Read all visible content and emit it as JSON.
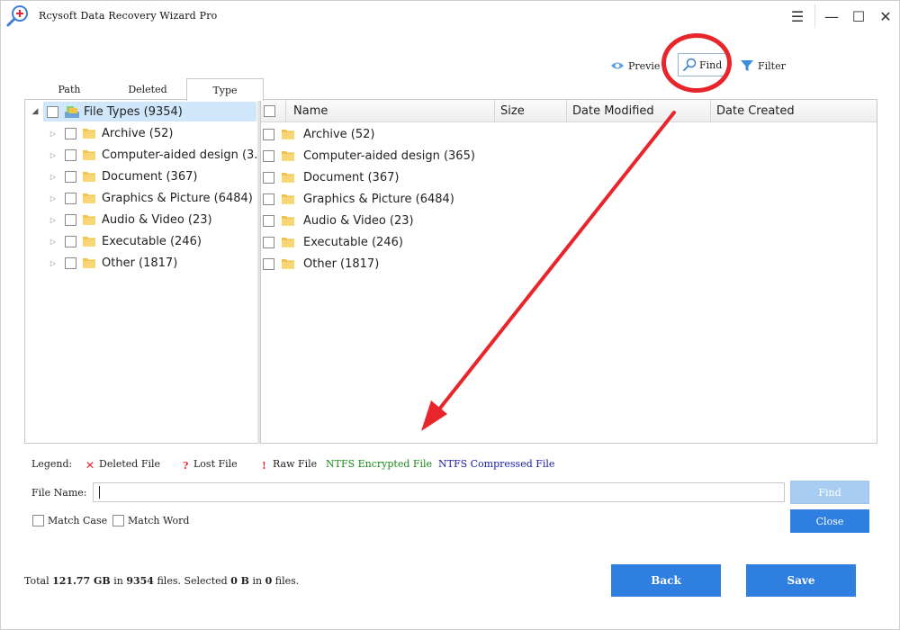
{
  "window": {
    "title": "Rcysoft Data Recovery Wizard Pro",
    "controls": {
      "menu": "☰",
      "minimize": "—",
      "maximize": "☐",
      "close": "✕"
    }
  },
  "toolbar": {
    "preview_label": "Previe",
    "find_label": "Find",
    "filter_label": "Filter"
  },
  "tabs": [
    {
      "label": "Path"
    },
    {
      "label": "Deleted"
    },
    {
      "label": "Type",
      "active": true
    }
  ],
  "tree": {
    "root": {
      "label": "File Types (9354)",
      "expander": "◢"
    },
    "items": [
      {
        "label": "Archive (52)"
      },
      {
        "label": "Computer-aided design (3..."
      },
      {
        "label": "Document (367)"
      },
      {
        "label": "Graphics & Picture (6484)"
      },
      {
        "label": "Audio & Video (23)"
      },
      {
        "label": "Executable (246)"
      },
      {
        "label": "Other (1817)"
      }
    ],
    "expander_glyph": "▷"
  },
  "list": {
    "columns": [
      "Name",
      "Size",
      "Date Modified",
      "Date Created"
    ],
    "rows": [
      {
        "name": "Archive (52)"
      },
      {
        "name": "Computer-aided design (365)"
      },
      {
        "name": "Document (367)"
      },
      {
        "name": "Graphics & Picture (6484)"
      },
      {
        "name": "Audio & Video (23)"
      },
      {
        "name": "Executable (246)"
      },
      {
        "name": "Other (1817)"
      }
    ]
  },
  "legend": {
    "label": "Legend:",
    "deleted": {
      "mark": "✕",
      "text": "Deleted File",
      "color": "#e8252a"
    },
    "lost": {
      "mark": "?",
      "text": "Lost File",
      "color": "#e8252a"
    },
    "raw": {
      "mark": "!",
      "text": "Raw File",
      "color": "#e8252a"
    },
    "encrypted": {
      "text": "NTFS Encrypted File",
      "color": "#1a8a1a"
    },
    "compressed": {
      "text": "NTFS Compressed File",
      "color": "#1a1aa8"
    }
  },
  "find_panel": {
    "file_name_label": "File Name:",
    "file_name_value": "",
    "find_label": "Find",
    "close_label": "Close",
    "match_case_label": "Match Case",
    "match_word_label": "Match Word"
  },
  "status": {
    "prefix": "Total",
    "total_size": "121.77 GB",
    "in1": "in",
    "total_files": "9354",
    "files_selected": "files. Selected",
    "selected_size": "0 B",
    "in2": "in",
    "selected_files": "0",
    "suffix": "files."
  },
  "actions": {
    "back_label": "Back",
    "save_label": "Save"
  },
  "colors": {
    "accent": "#2f7fe0",
    "annotation": "#e8252a",
    "selection": "#cfe6fb"
  }
}
